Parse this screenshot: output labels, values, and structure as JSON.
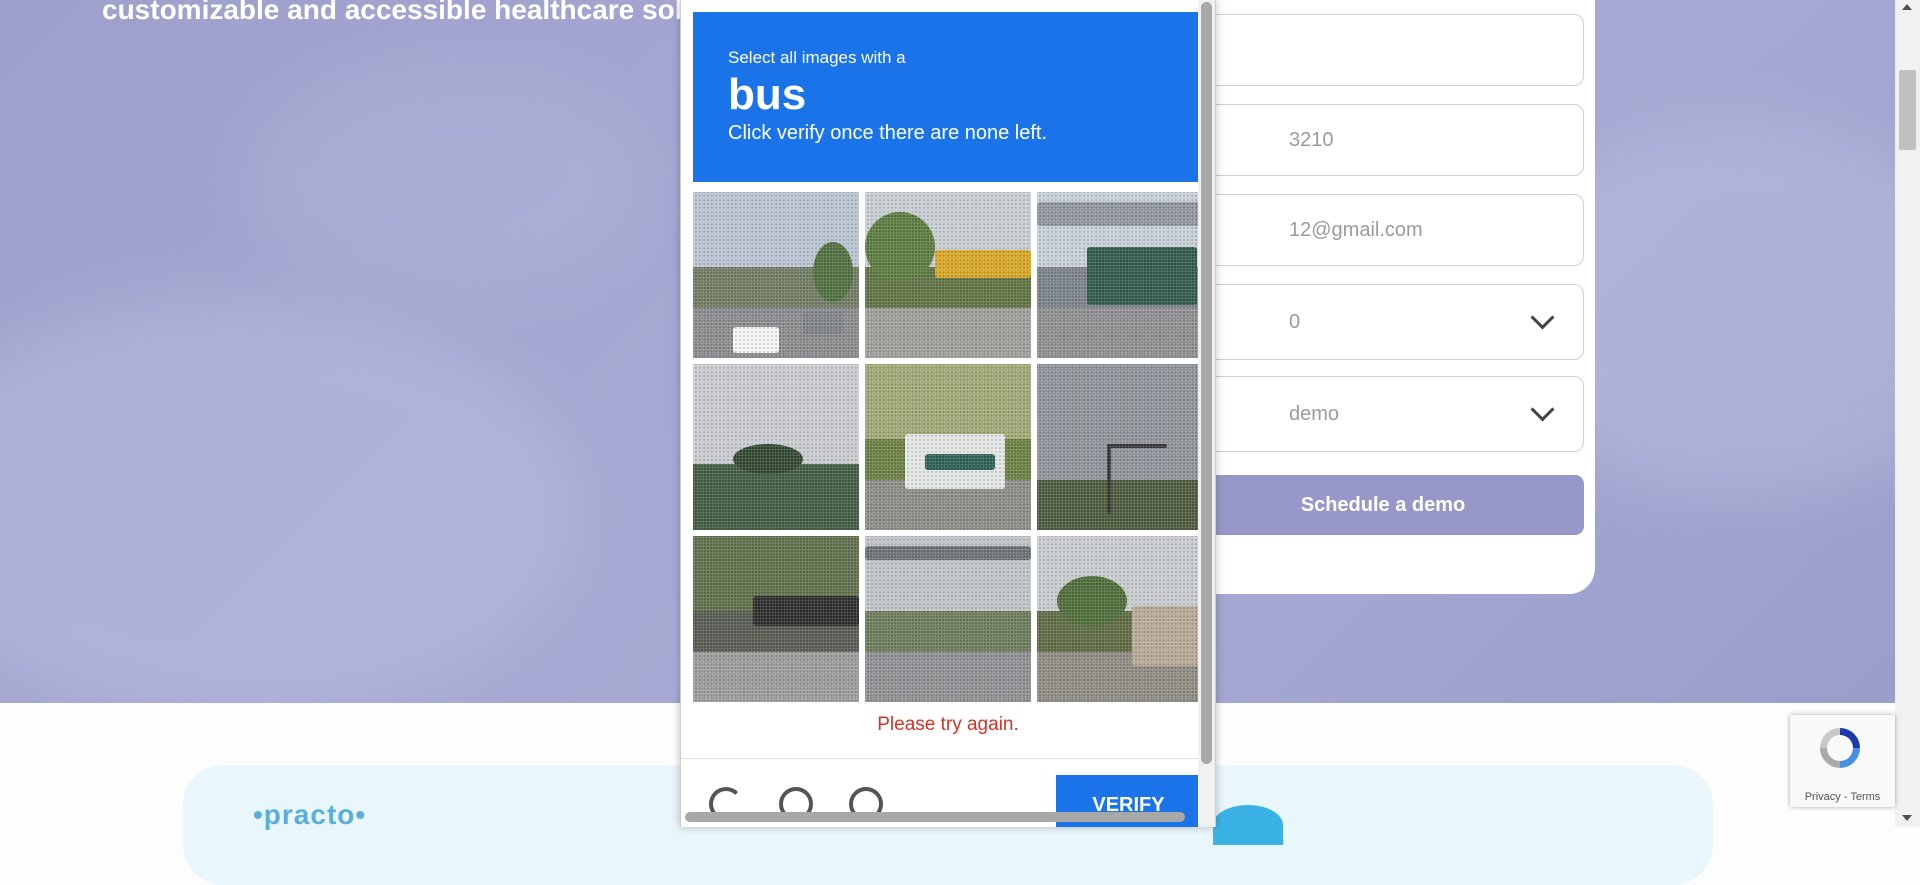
{
  "hero": {
    "headline": "customizable and accessible healthcare solu"
  },
  "form": {
    "name_value": "",
    "phone_value": "3210",
    "email_value": "12@gmail.com",
    "select1_value": "0",
    "select2_value": " demo",
    "schedule_label": "Schedule a demo"
  },
  "logos": {
    "practo": "•practo•"
  },
  "captcha": {
    "instruction_pre": "Select all images with a",
    "target": "bus",
    "instruction_sub": "Click verify once there are none left.",
    "error": "Please try again.",
    "verify_label": "VERIFY",
    "tiles": [
      {
        "scene": "street-cars"
      },
      {
        "scene": "school-buses"
      },
      {
        "scene": "city-bus"
      },
      {
        "scene": "palm-trees"
      },
      {
        "scene": "bus-trees"
      },
      {
        "scene": "traffic-light"
      },
      {
        "scene": "fence-road"
      },
      {
        "scene": "highway"
      },
      {
        "scene": "palm-house"
      }
    ],
    "icons": [
      "reload-icon",
      "audio-icon",
      "info-icon"
    ],
    "accent": "#1a73e8",
    "error_color": "#d93025"
  },
  "recaptcha_badge": {
    "links": "Privacy - Terms"
  }
}
